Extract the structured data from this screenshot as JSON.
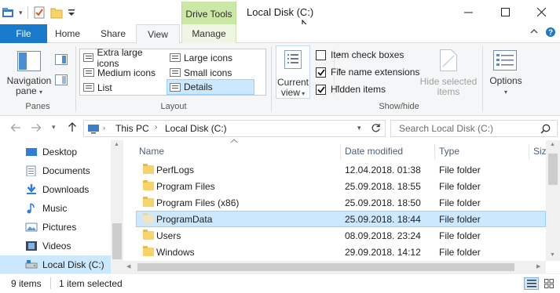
{
  "window": {
    "title": "Local Disk (C:)",
    "contextual_tab": "Drive Tools",
    "controls": [
      "minimize",
      "maximize",
      "close"
    ]
  },
  "ribbon_tabs": {
    "file": "File",
    "home": "Home",
    "share": "Share",
    "view": "View",
    "manage": "Manage",
    "active": "View"
  },
  "ribbon": {
    "panes": {
      "group_label": "Panes",
      "navigation_pane": "Navigation pane",
      "navigation_pane_line1": "Navigation",
      "navigation_pane_line2": "pane"
    },
    "layout": {
      "group_label": "Layout",
      "options": [
        "Extra large icons",
        "Large icons",
        "Medium icons",
        "Small icons",
        "List",
        "Details"
      ],
      "selected": "Details"
    },
    "current_view": {
      "line1": "Current",
      "line2": "view"
    },
    "show_hide": {
      "group_label": "Show/hide",
      "item_check_boxes": {
        "label": "Item check boxes",
        "checked": false
      },
      "file_name_extensions": {
        "label": "File name extensions",
        "checked": true
      },
      "hidden_items": {
        "label": "Hidden items",
        "checked": true
      },
      "hide_selected_line1": "Hide selected",
      "hide_selected_line2": "items"
    },
    "options": "Options"
  },
  "address_bar": {
    "path": [
      "This PC",
      "Local Disk (C:)"
    ],
    "search_placeholder": "Search Local Disk (C:)"
  },
  "nav_pane": {
    "items": [
      {
        "label": "Desktop",
        "icon": "desktop-icon"
      },
      {
        "label": "Documents",
        "icon": "documents-icon"
      },
      {
        "label": "Downloads",
        "icon": "downloads-icon"
      },
      {
        "label": "Music",
        "icon": "music-icon"
      },
      {
        "label": "Pictures",
        "icon": "pictures-icon"
      },
      {
        "label": "Videos",
        "icon": "videos-icon"
      },
      {
        "label": "Local Disk (C:)",
        "icon": "drive-icon",
        "selected": true
      }
    ]
  },
  "file_list": {
    "columns": {
      "name": "Name",
      "date": "Date modified",
      "type": "Type",
      "size": "Size"
    },
    "rows": [
      {
        "name": "PerfLogs",
        "date": "12.04.2018. 01:38",
        "type": "File folder"
      },
      {
        "name": "Program Files",
        "date": "25.09.2018. 18:55",
        "type": "File folder"
      },
      {
        "name": "Program Files (x86)",
        "date": "25.09.2018. 18:50",
        "type": "File folder"
      },
      {
        "name": "ProgramData",
        "date": "25.09.2018. 18:44",
        "type": "File folder",
        "selected": true
      },
      {
        "name": "Users",
        "date": "08.09.2018. 23:24",
        "type": "File folder"
      },
      {
        "name": "Windows",
        "date": "29.09.2018. 14:12",
        "type": "File folder"
      }
    ]
  },
  "status_bar": {
    "item_count": "9 items",
    "selection": "1 item selected"
  },
  "colors": {
    "file_tab": "#1979ca",
    "drive_tools": "#cbe8a7",
    "selection": "#cce8ff",
    "selection_border": "#99d1ff"
  }
}
